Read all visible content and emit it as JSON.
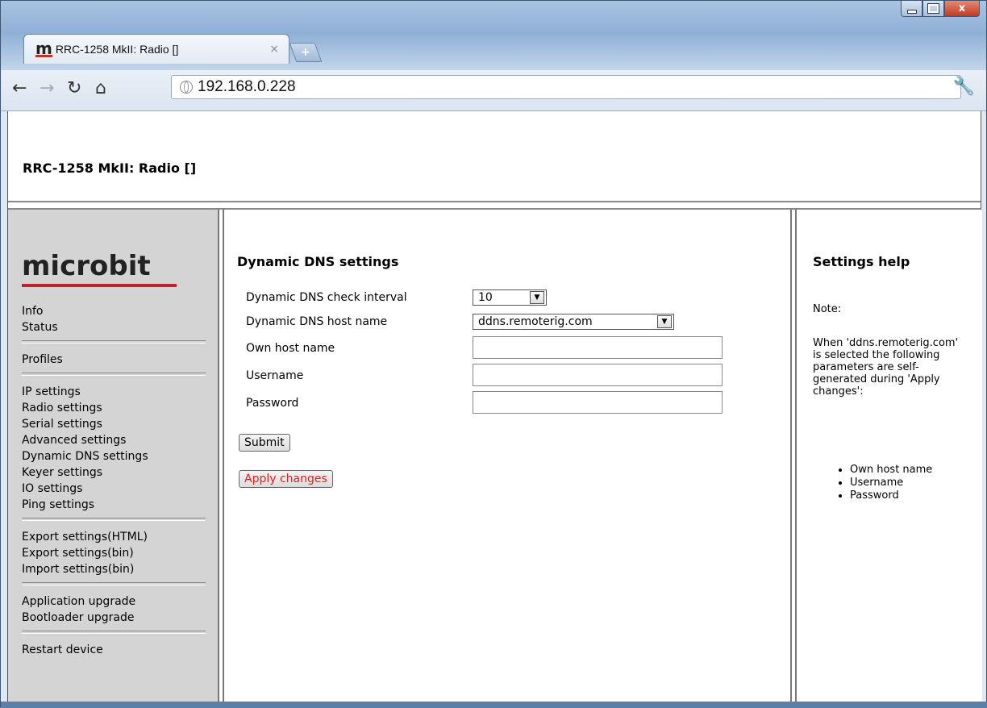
{
  "browser": {
    "tab_title": "RRC-1258 MkII: Radio []",
    "tab_favicon": "m",
    "tab_close": "×",
    "new_tab": "+",
    "url": "192.168.0.228",
    "window_close": "x"
  },
  "page": {
    "header_title": "RRC-1258 MkII: Radio []",
    "logo": "microbit"
  },
  "sidebar": {
    "groups": [
      [
        "Info",
        "Status"
      ],
      [
        "Profiles"
      ],
      [
        "IP settings",
        "Radio settings",
        "Serial settings",
        "Advanced settings",
        "Dynamic DNS settings",
        "Keyer settings",
        "IO settings",
        "Ping settings"
      ],
      [
        "Export settings(HTML)",
        "Export settings(bin)",
        "Import settings(bin)"
      ],
      [
        "Application upgrade",
        "Bootloader upgrade"
      ],
      [
        "Restart device"
      ]
    ]
  },
  "main": {
    "title": "Dynamic DNS settings",
    "fields": {
      "check_interval_label": "Dynamic DNS check interval",
      "check_interval_value": "10",
      "host_name_label": "Dynamic DNS host name",
      "host_name_value": "ddns.remoterig.com",
      "own_host_label": "Own host name",
      "username_label": "Username",
      "password_label": "Password"
    },
    "submit_label": "Submit",
    "apply_label": "Apply changes"
  },
  "help": {
    "title": "Settings help",
    "note": "Note:",
    "text": "When 'ddns.remoterig.com' is selected the following parameters are self-generated during 'Apply changes':",
    "items": [
      "Own host name",
      "Username",
      "Password"
    ]
  },
  "colors": {
    "logo_accent": "#b8232f",
    "apply_text": "#e02020",
    "sidebar_bg": "#d4d4d4"
  }
}
